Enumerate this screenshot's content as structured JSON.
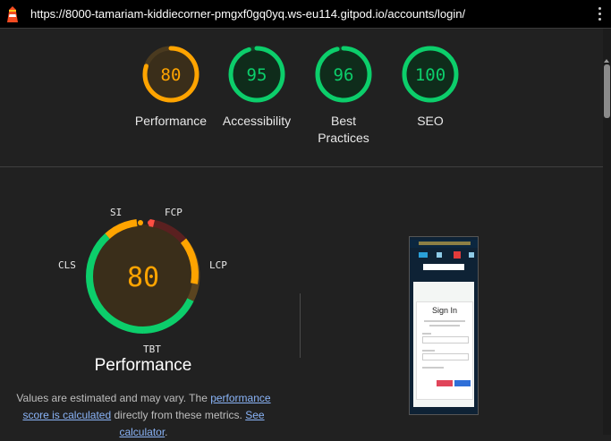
{
  "browser": {
    "url": "https://8000-tamariam-kiddiecorner-pmgxf0gq0yq.ws-eu114.gitpod.io/accounts/login/"
  },
  "gauges": [
    {
      "score": "80",
      "label": "Performance",
      "value": 0.8,
      "color": "#ffa400"
    },
    {
      "score": "95",
      "label": "Accessibility",
      "value": 0.95,
      "color": "#0cce6b"
    },
    {
      "score": "96",
      "label": "Best Practices",
      "value": 0.96,
      "color": "#0cce6b"
    },
    {
      "score": "100",
      "label": "SEO",
      "value": 1.0,
      "color": "#0cce6b"
    }
  ],
  "performance": {
    "score": "80",
    "title": "Performance",
    "metrics": {
      "si": "SI",
      "fcp": "FCP",
      "lcp": "LCP",
      "tbt": "TBT",
      "cls": "CLS"
    },
    "note_pre": "Values are estimated and may vary. The ",
    "note_link1": "performance score is calculated",
    "note_mid": " directly from these metrics. ",
    "note_link2": "See calculator",
    "note_end": "."
  },
  "phone_preview": {
    "title": "Sign In"
  },
  "colors": {
    "orange": "#ffa400",
    "green": "#0cce6b",
    "red": "#ff4e42"
  }
}
